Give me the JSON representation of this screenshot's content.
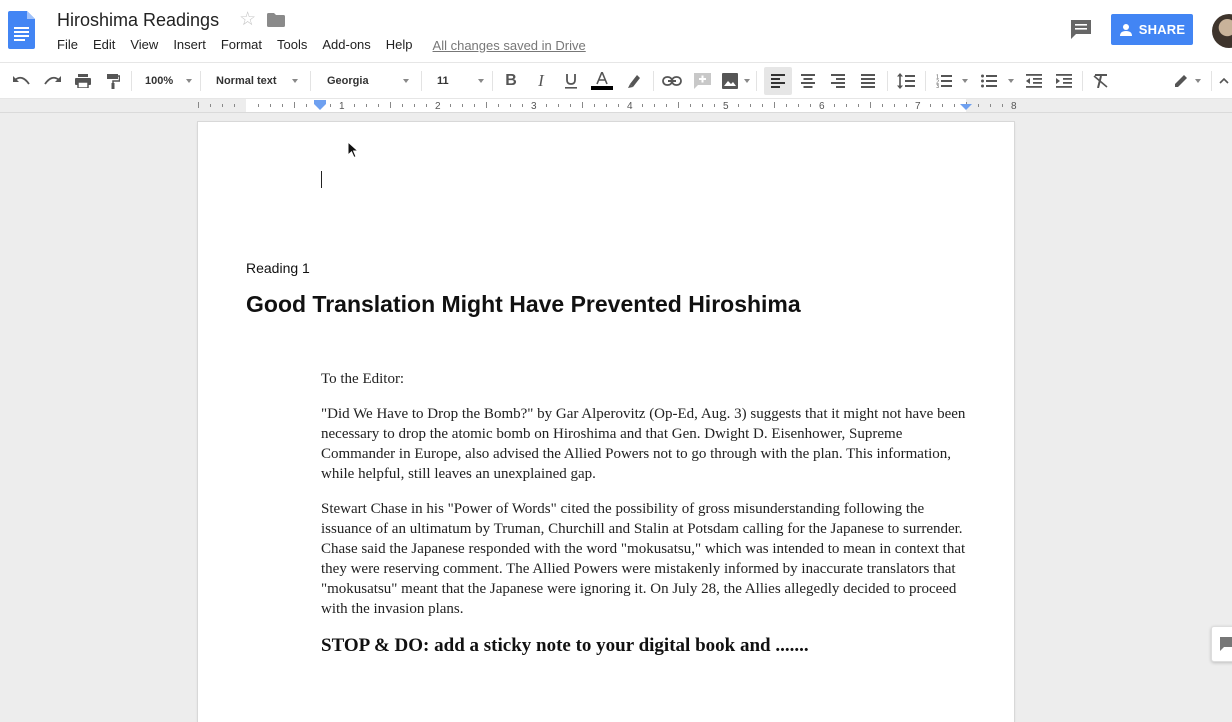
{
  "app": {
    "doc_title": "Hiroshima Readings",
    "save_status": "All changes saved in Drive",
    "share_label": "SHARE"
  },
  "menu": [
    "File",
    "Edit",
    "View",
    "Insert",
    "Format",
    "Tools",
    "Add-ons",
    "Help"
  ],
  "toolbar": {
    "zoom": "100%",
    "style": "Normal text",
    "font": "Georgia",
    "font_size": "11",
    "text_color": "#000000",
    "icons": [
      "undo-icon",
      "redo-icon",
      "print-icon",
      "paint-format-icon",
      "bold-icon",
      "italic-icon",
      "underline-icon",
      "text-color-icon",
      "highlight-icon",
      "link-icon",
      "add-comment-icon",
      "image-icon",
      "align-left-icon",
      "align-center-icon",
      "align-right-icon",
      "justify-icon",
      "line-spacing-icon",
      "numbered-list-icon",
      "bulleted-list-icon",
      "decrease-indent-icon",
      "increase-indent-icon",
      "clear-formatting-icon",
      "editing-mode-icon"
    ]
  },
  "ruler": {
    "numbers": [
      "1",
      "2",
      "3",
      "4",
      "5",
      "6",
      "7",
      "8"
    ]
  },
  "document": {
    "reading_label": "Reading 1",
    "heading": "Good Translation Might Have Prevented Hiroshima",
    "salutation": "To the Editor:",
    "paragraph_1": "\"Did We Have to Drop the Bomb?\" by Gar Alperovitz (Op-Ed, Aug. 3) suggests that it might not have been necessary to drop the atomic bomb on Hiroshima and that Gen. Dwight D. Eisenhower, Supreme Commander in Europe, also advised the Allied Powers not to go through with the plan. This information, while helpful, still leaves an unexplained gap.",
    "paragraph_2": "Stewart Chase in his \"Power of Words\" cited the possibility of gross misunderstanding following the issuance of an ultimatum by Truman, Churchill and Stalin at Potsdam calling for the Japanese to surrender. Chase said the Japanese responded with the word \"mokusatsu,\" which was intended to mean in context that they were reserving comment. The Allied Powers were mistakenly informed by inaccurate translators that \"mokusatsu\" meant that the Japanese were ignoring it. On July 28, the Allies allegedly decided to proceed with the invasion plans.",
    "stop_do": "STOP & DO: add a sticky note to your digital book and ......."
  },
  "colors": {
    "accent": "#4285f4",
    "doc_icon": "#4285f4"
  }
}
